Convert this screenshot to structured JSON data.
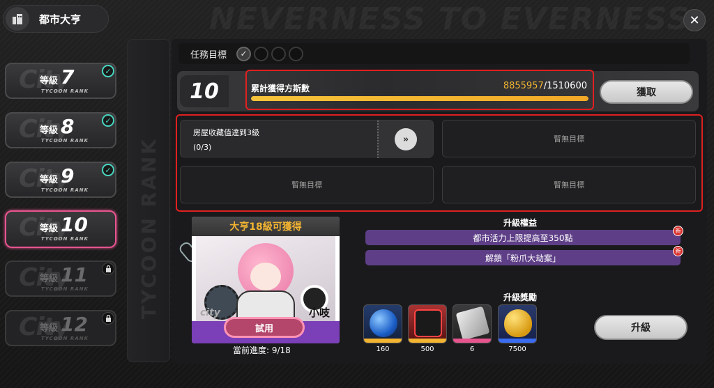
{
  "header": {
    "title": "都市大亨",
    "close_symbol": "✕"
  },
  "levels": [
    {
      "word": "等級",
      "num": "7",
      "sub": "TYCOON RANK",
      "state": "done"
    },
    {
      "word": "等級",
      "num": "8",
      "sub": "TYCOON RANK",
      "state": "done"
    },
    {
      "word": "等級",
      "num": "9",
      "sub": "TYCOON RANK",
      "state": "done"
    },
    {
      "word": "等級",
      "num": "10",
      "sub": "TYCOON RANK",
      "state": "active"
    },
    {
      "word": "等級",
      "num": "11",
      "sub": "TYCOON RANK",
      "state": "locked"
    },
    {
      "word": "等級",
      "num": "12",
      "sub": "TYCOON RANK",
      "state": "locked"
    }
  ],
  "rail_text": "TYCOON RANK",
  "mission": {
    "label": "任務目標",
    "completed": 1,
    "total": 4
  },
  "progress": {
    "rank": "10",
    "label": "累計獲得方斯數",
    "current": "8855957",
    "target": "/1510600",
    "fraction": 1.0,
    "claim_label": "獲取"
  },
  "targets": {
    "first": {
      "text": "房屋收藏值達到3級",
      "count": "(0/3)",
      "goto_symbol": "»"
    },
    "empty_label": "暫無目標"
  },
  "reward_card": {
    "header": "大亨18級可獲得",
    "character_name": "小吱",
    "city_mark": "city",
    "trial_label": "試用",
    "current_progress": "當前進度: 9/18"
  },
  "benefits": {
    "title": "升級權益",
    "items": [
      {
        "text": "都市活力上限提高至350點",
        "badge": "新"
      },
      {
        "text": "解鎖「粉爪大劫案」",
        "badge": "新"
      }
    ]
  },
  "rewards": {
    "title": "升級獎勵",
    "items": [
      {
        "icon": "blue-orb-icon",
        "qty": "160"
      },
      {
        "icon": "hunter-ticket-icon",
        "qty": "500"
      },
      {
        "icon": "card-pack-icon",
        "qty": "6"
      },
      {
        "icon": "gold-egg-icon",
        "qty": "7500"
      }
    ]
  },
  "upgrade_label": "升級",
  "colors": {
    "accent_gold": "#f2b431",
    "accent_pink": "#e7558f",
    "check_teal": "#47d6c0",
    "highlight_red": "#e02020"
  }
}
